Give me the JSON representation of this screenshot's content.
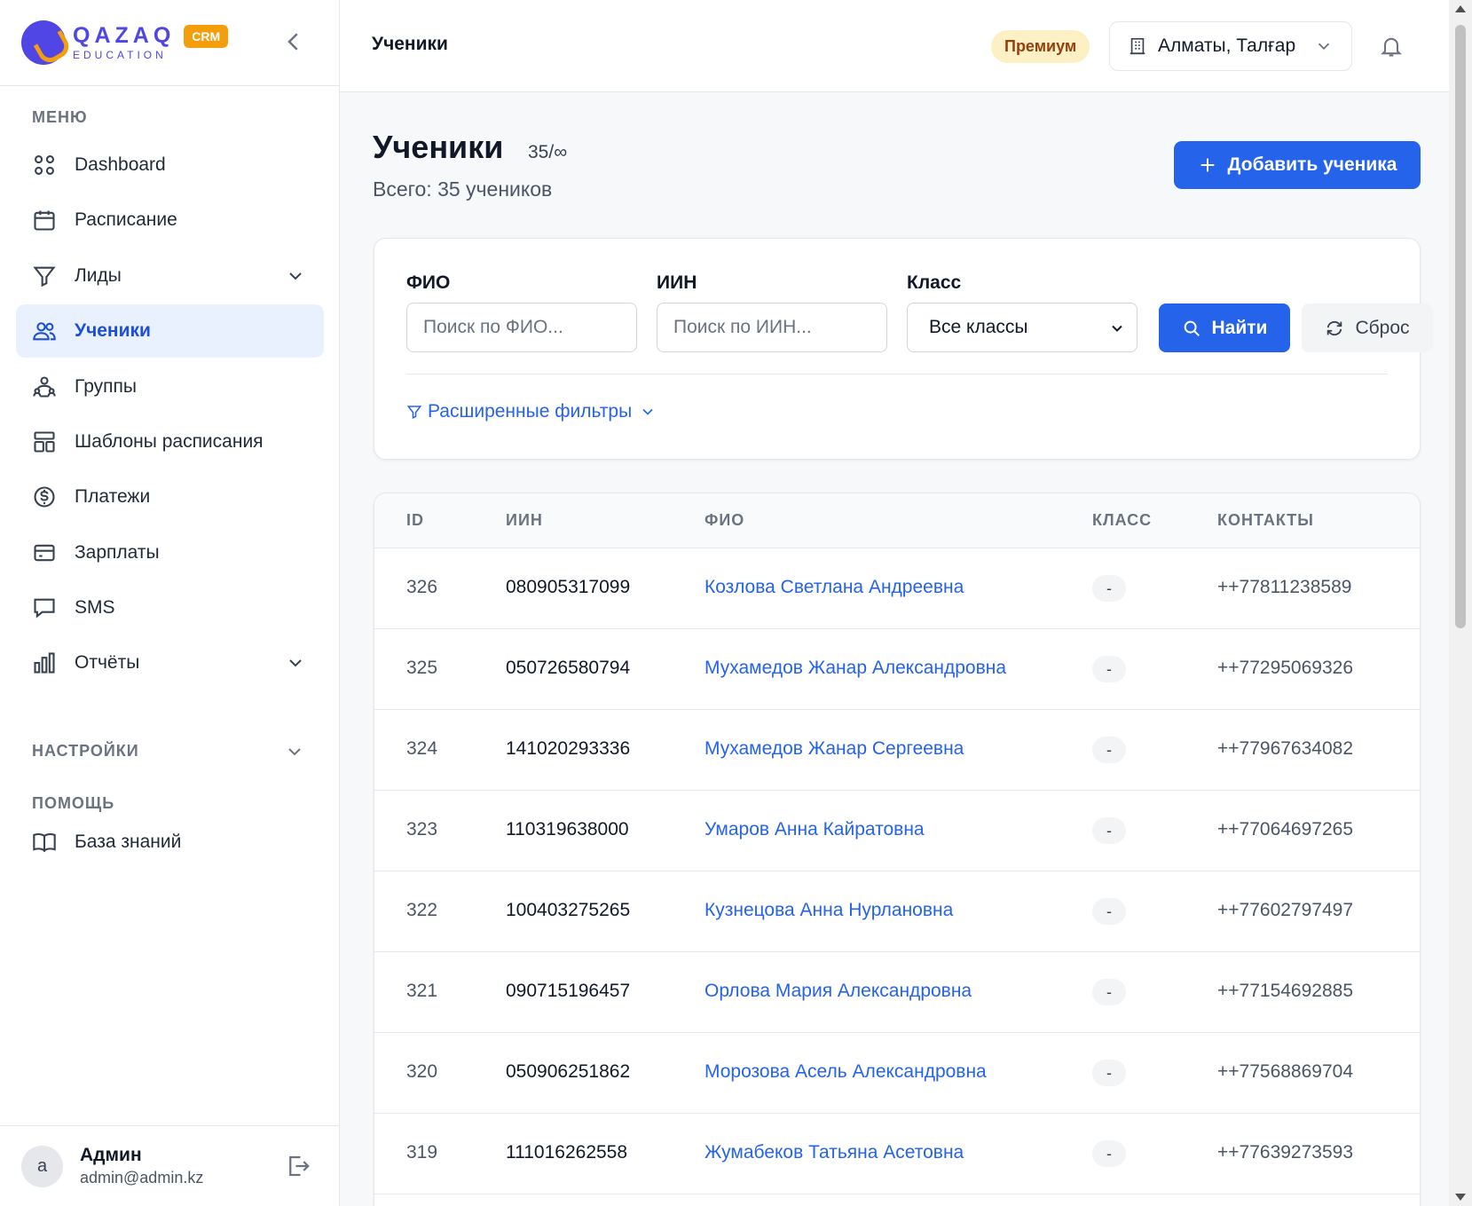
{
  "sidebar": {
    "logo": {
      "main": "QAZAQ",
      "sub": "EDUCATION",
      "badge": "CRM"
    },
    "menu_label": "МЕНЮ",
    "items": [
      {
        "label": "Dashboard",
        "icon": "dashboard-icon"
      },
      {
        "label": "Расписание",
        "icon": "calendar-icon"
      },
      {
        "label": "Лиды",
        "icon": "funnel-icon"
      },
      {
        "label": "Ученики",
        "icon": "students-icon",
        "active": true
      },
      {
        "label": "Группы",
        "icon": "groups-icon"
      },
      {
        "label": "Шаблоны расписания",
        "icon": "template-icon"
      },
      {
        "label": "Платежи",
        "icon": "dollar-icon"
      },
      {
        "label": "Зарплаты",
        "icon": "card-icon"
      },
      {
        "label": "SMS",
        "icon": "message-icon"
      },
      {
        "label": "Отчёты",
        "icon": "chart-icon"
      }
    ],
    "settings_label": "НАСТРОЙКИ",
    "help_label": "ПОМОЩЬ",
    "help_items": [
      {
        "label": "База знаний",
        "icon": "book-icon"
      }
    ],
    "user": {
      "initial": "a",
      "name": "Админ",
      "email": "admin@admin.kz"
    }
  },
  "topbar": {
    "title": "Ученики",
    "plan_badge": "Премиум",
    "branch": "Алматы, Талғар"
  },
  "page": {
    "title": "Ученики",
    "count": "35/∞",
    "subtitle": "Всего: 35 учеников",
    "add_button": "Добавить ученика"
  },
  "filters": {
    "name_label": "ФИО",
    "name_placeholder": "Поиск по ФИО...",
    "iin_label": "ИИН",
    "iin_placeholder": "Поиск по ИИН...",
    "class_label": "Класс",
    "class_value": "Все классы",
    "find_button": "Найти",
    "reset_button": "Сброс",
    "advanced": "Расширенные фильтры"
  },
  "table": {
    "columns": [
      "ID",
      "ИИН",
      "ФИО",
      "КЛАСС",
      "КОНТАКТЫ"
    ],
    "rows": [
      {
        "id": "326",
        "iin": "080905317099",
        "name": "Козлова Светлана Андреевна",
        "class": "-",
        "contact": "++77811238589"
      },
      {
        "id": "325",
        "iin": "050726580794",
        "name": "Мухамедов Жанар Александровна",
        "class": "-",
        "contact": "++77295069326"
      },
      {
        "id": "324",
        "iin": "141020293336",
        "name": "Мухамедов Жанар Сергеевна",
        "class": "-",
        "contact": "++77967634082"
      },
      {
        "id": "323",
        "iin": "110319638000",
        "name": "Умаров Анна Кайратовна",
        "class": "-",
        "contact": "++77064697265"
      },
      {
        "id": "322",
        "iin": "100403275265",
        "name": "Кузнецова Анна Нурлановна",
        "class": "-",
        "contact": "++77602797497"
      },
      {
        "id": "321",
        "iin": "090715196457",
        "name": "Орлова Мария Александровна",
        "class": "-",
        "contact": "++77154692885"
      },
      {
        "id": "320",
        "iin": "050906251862",
        "name": "Морозова Асель Александровна",
        "class": "-",
        "contact": "++77568869704"
      },
      {
        "id": "319",
        "iin": "111016262558",
        "name": "Жумабеков Татьяна Асетовна",
        "class": "-",
        "contact": "++77639273593"
      }
    ]
  },
  "colors": {
    "primary": "#2563eb",
    "brand": "#4f46e5",
    "accent": "#f59e0b",
    "active_bg": "#eaf1fe"
  }
}
